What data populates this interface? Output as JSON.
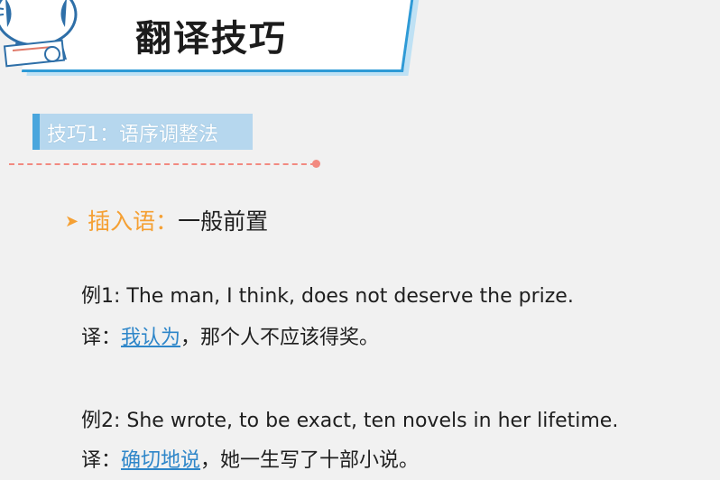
{
  "header": {
    "title": "翻译技巧"
  },
  "tag": {
    "label": "技巧1：语序调整法"
  },
  "point": {
    "term": "插入语：",
    "desc": "一般前置"
  },
  "examples": [
    {
      "sentence": "例1: The man, I think, does not deserve the prize.",
      "trans_prefix": "译：",
      "trans_highlight": "我认为",
      "trans_rest": "，那个人不应该得奖。"
    },
    {
      "sentence": "例2: She wrote, to be exact, ten novels in her lifetime.",
      "trans_prefix": "译：",
      "trans_highlight": "确切地说",
      "trans_rest": "，她一生写了十部小说。"
    }
  ],
  "colors": {
    "accent_blue": "#2e9ad6",
    "accent_orange": "#f5a033",
    "dash_red": "#f28a80"
  }
}
